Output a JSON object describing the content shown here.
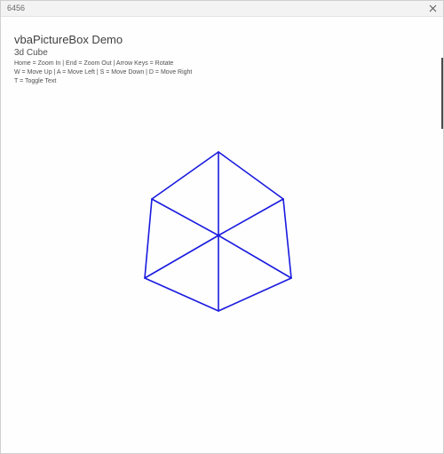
{
  "window": {
    "title": "6456",
    "close_icon": "close-icon"
  },
  "demo": {
    "title": "vbaPictureBox Demo",
    "subtitle": "3d Cube",
    "help_lines": [
      "Home = Zoom In   |  End = Zoom Out | Arrow Keys = Rotate",
      "W = Move Up   |   A = Move Left   |   S = Move Down   |   D = Move Right",
      "T = Toggle Text"
    ]
  },
  "cube": {
    "stroke_color": "#1a1ae0"
  }
}
